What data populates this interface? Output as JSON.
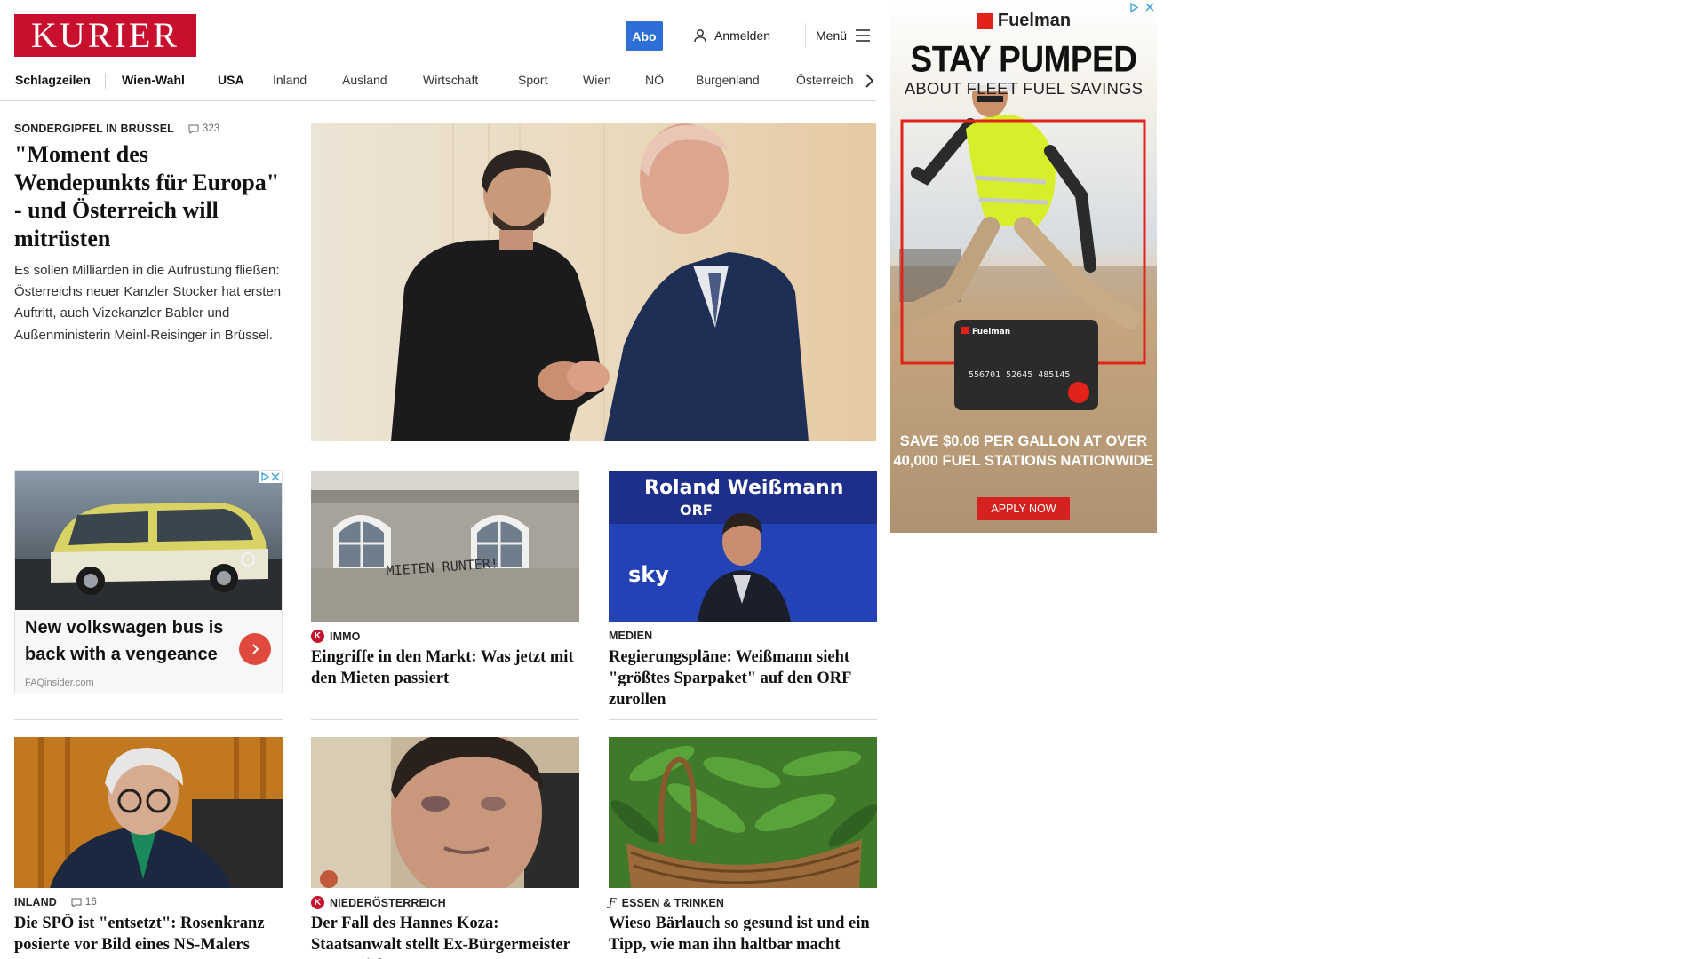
{
  "header": {
    "logo_text": "KURIER",
    "abo_label": "Abo",
    "login_label": "Anmelden",
    "menu_label": "Menü"
  },
  "nav": {
    "items": [
      "Schlagzeilen",
      "Wien-Wahl",
      "USA",
      "Inland",
      "Ausland",
      "Wirtschaft",
      "Sport",
      "Wien",
      "NÖ",
      "Burgenland",
      "Österreich"
    ]
  },
  "lead": {
    "kicker": "SONDERGIPFEL IN BRÜSSEL",
    "comments": "323",
    "title": "\"Moment des Wendepunkts für Europa\" - und Österreich will mitrüsten",
    "teaser": "Es sollen Milliarden in die Aufrüstung fließen: Österreichs neuer Kanzler Stocker hat ersten Auftritt, auch Vizekanzler Babler und Außenministerin Meinl-Reisinger in Brüssel."
  },
  "sponsored": {
    "title": "New volkswagen bus is back with a vengeance",
    "source": "FAQinsider.com"
  },
  "cards": [
    {
      "kicker": "IMMO",
      "badge": "K",
      "title": "Eingriffe in den Markt: Was jetzt mit den Mieten passiert",
      "image_text": "MIETEN RUNTER!"
    },
    {
      "kicker": "MEDIEN",
      "title": "Regierungspläne: Weißmann sieht \"größtes Sparpaket\" auf den ORF zurollen",
      "image_text": [
        "Roland Weißmann",
        "ORF",
        "sky"
      ]
    },
    {
      "kicker": "INLAND",
      "comments": "16",
      "title": "Die SPÖ ist \"entsetzt\": Rosenkranz posierte vor Bild eines NS-Malers"
    },
    {
      "kicker": "NIEDERÖSTERREICH",
      "badge": "K",
      "title": "Der Fall des Hannes Koza: Staatsanwalt stellt Ex-Bürgermeister vor Gericht"
    },
    {
      "kicker": "ESSEN & TRINKEN",
      "title": "Wieso Bärlauch so gesund ist und ein Tipp, wie man ihn haltbar macht"
    }
  ],
  "ad": {
    "brand": "Fuelman",
    "headline": "STAY PUMPED",
    "subline": "ABOUT FLEET FUEL SAVINGS",
    "card_number": "556701 52645 485145",
    "offer": "SAVE $0.08 PER GALLON AT OVER 40,000 FUEL STATIONS NATIONWIDE",
    "cta": "APPLY NOW"
  },
  "colors": {
    "brand_red": "#c8102e",
    "abo_blue": "#2d6fd6",
    "ad_red": "#e2231a",
    "sponsored_arrow": "#e04a3e"
  }
}
